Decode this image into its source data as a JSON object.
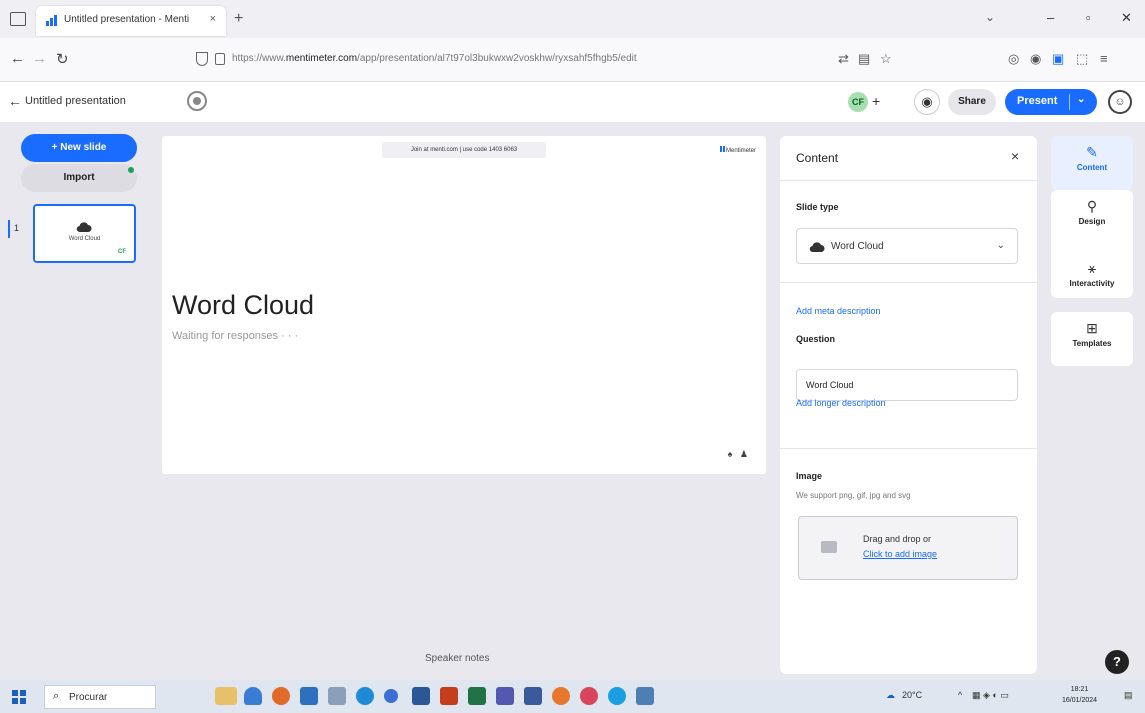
{
  "browser": {
    "tab_title": "Untitled presentation - Menti",
    "tab_close": "×",
    "new_tab": "+",
    "url_prefix": "https://www.",
    "url_domain": "mentimeter.com",
    "url_path": "/app/presentation/al7t97ol3bukwxw2voskhw/ryxsahf5fhgb5/edit"
  },
  "app": {
    "title": "Untitled presentation",
    "collaborator_initials": "CF",
    "share_label": "Share",
    "present_label": "Present",
    "new_slide_label": "+ New slide",
    "import_label": "Import",
    "slide_number": "1",
    "thumb_label": "Word Cloud",
    "thumb_badge": "CF",
    "speaker_notes": "Speaker notes"
  },
  "slide": {
    "join_text": "Join at menti.com | use code 1403 6063",
    "logo_text": "Mentimeter",
    "heading": "Word Cloud",
    "subtitle": "Waiting for responses · · ·"
  },
  "panel": {
    "title": "Content",
    "close": "×",
    "slide_type_label": "Slide type",
    "slide_type_value": "Word Cloud",
    "add_meta": "Add meta description",
    "question_label": "Question",
    "question_value": "Word Cloud",
    "add_longer": "Add longer description",
    "image_label": "Image",
    "image_support": "We support png, gif, jpg and svg",
    "drag_text": "Drag and drop or",
    "click_add": "Click to add image"
  },
  "rail": {
    "content": "Content",
    "design": "Design",
    "interactivity": "Interactivity",
    "templates": "Templates"
  },
  "taskbar": {
    "search_placeholder": "Procurar",
    "temperature": "20°C",
    "time": "18:21",
    "date": "16/01/2024"
  },
  "colors": {
    "accent": "#196cff",
    "workspace_bg": "#e8e8ee",
    "taskbar_bg": "#dfe6ef"
  }
}
